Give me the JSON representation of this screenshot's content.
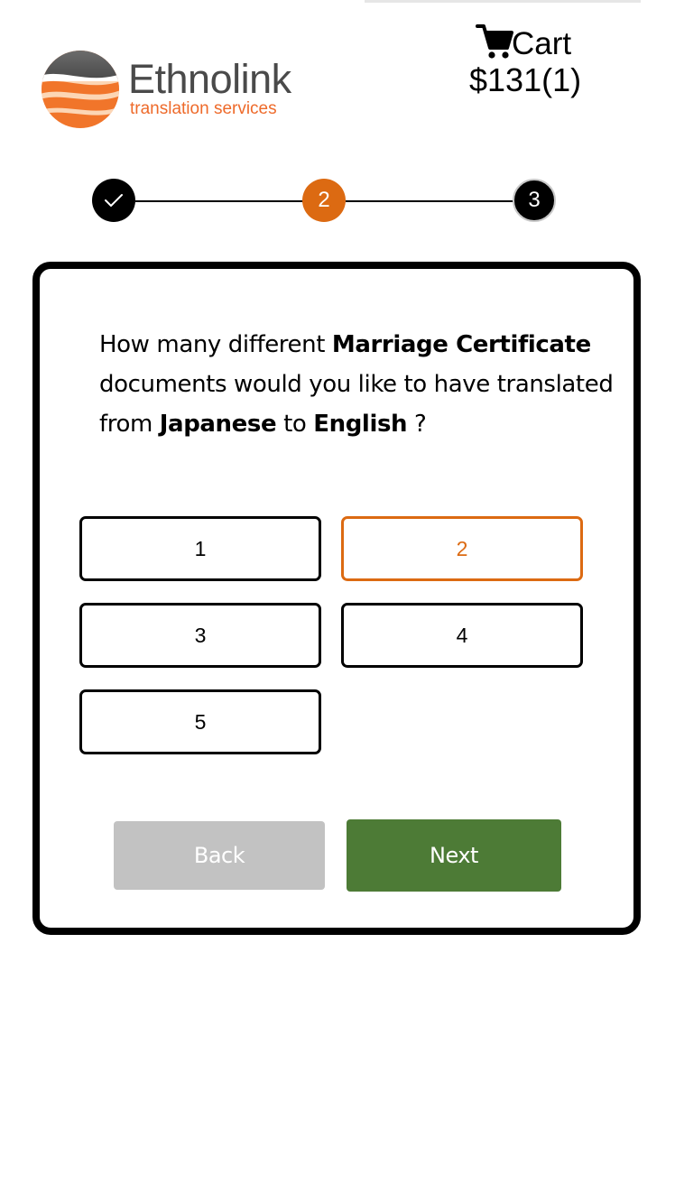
{
  "brand": {
    "name": "Ethnolink",
    "tagline": "translation services"
  },
  "cart": {
    "icon": "cart-icon",
    "label": "Cart",
    "total": "$131(1)"
  },
  "stepper": {
    "steps": [
      {
        "label": "",
        "state": "done",
        "icon": "check-icon"
      },
      {
        "label": "2",
        "state": "current"
      },
      {
        "label": "3",
        "state": "upcoming"
      }
    ]
  },
  "question": {
    "prefix": "How many different ",
    "document_type": "Marriage Certificate",
    "middle": " documents would you like to have translated from ",
    "source_language": "Japanese",
    "connector": " to ",
    "target_language": "English",
    "suffix": " ?"
  },
  "options": [
    {
      "label": "1",
      "selected": false
    },
    {
      "label": "2",
      "selected": true
    },
    {
      "label": "3",
      "selected": false
    },
    {
      "label": "4",
      "selected": false
    },
    {
      "label": "5",
      "selected": false
    }
  ],
  "actions": {
    "back_label": "Back",
    "next_label": "Next"
  },
  "colors": {
    "accent": "#dc6a12",
    "next_button": "#4d7b36",
    "back_button": "#c2c2c2"
  }
}
